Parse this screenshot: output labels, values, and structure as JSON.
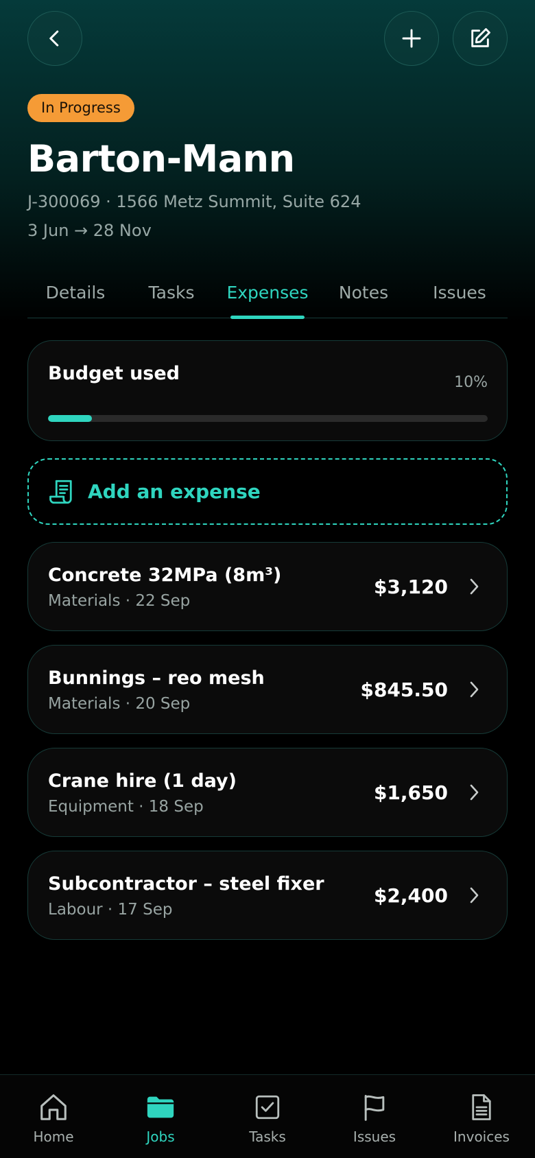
{
  "header": {
    "back_icon": "chevron-left-icon",
    "add_icon": "plus-icon",
    "edit_icon": "edit-icon"
  },
  "job": {
    "status": "In Progress",
    "status_color": "#f59b36",
    "name": "Barton-Mann",
    "reference_address": "J-300069 · 1566 Metz Summit, Suite 624",
    "dates": "3 Jun → 28 Nov"
  },
  "tabs": [
    {
      "label": "Details",
      "active": false
    },
    {
      "label": "Tasks",
      "active": false
    },
    {
      "label": "Expenses",
      "active": true
    },
    {
      "label": "Notes",
      "active": false
    },
    {
      "label": "Issues",
      "active": false
    }
  ],
  "budget": {
    "title": "Budget used",
    "percent_label": "10%",
    "fraction": 0.1
  },
  "add_expense": {
    "label": "Add an expense",
    "icon": "receipt-icon"
  },
  "expenses": [
    {
      "name": "Concrete 32MPa (8m³)",
      "meta": "Materials · 22 Sep",
      "amount": "$3,120"
    },
    {
      "name": "Bunnings – reo mesh",
      "meta": "Materials · 20 Sep",
      "amount": "$845.50"
    },
    {
      "name": "Crane hire (1 day)",
      "meta": "Equipment · 18 Sep",
      "amount": "$1,650"
    },
    {
      "name": "Subcontractor – steel fixer",
      "meta": "Labour · 17 Sep",
      "amount": "$2,400"
    }
  ],
  "bottom_nav": [
    {
      "label": "Home",
      "icon": "home-icon",
      "active": false
    },
    {
      "label": "Jobs",
      "icon": "folder-icon",
      "active": true
    },
    {
      "label": "Tasks",
      "icon": "checkbox-icon",
      "active": false
    },
    {
      "label": "Issues",
      "icon": "flag-icon",
      "active": false
    },
    {
      "label": "Invoices",
      "icon": "document-icon",
      "active": false
    }
  ],
  "colors": {
    "accent": "#2fd5bf",
    "background": "#000000",
    "card": "#0b0b0b"
  }
}
